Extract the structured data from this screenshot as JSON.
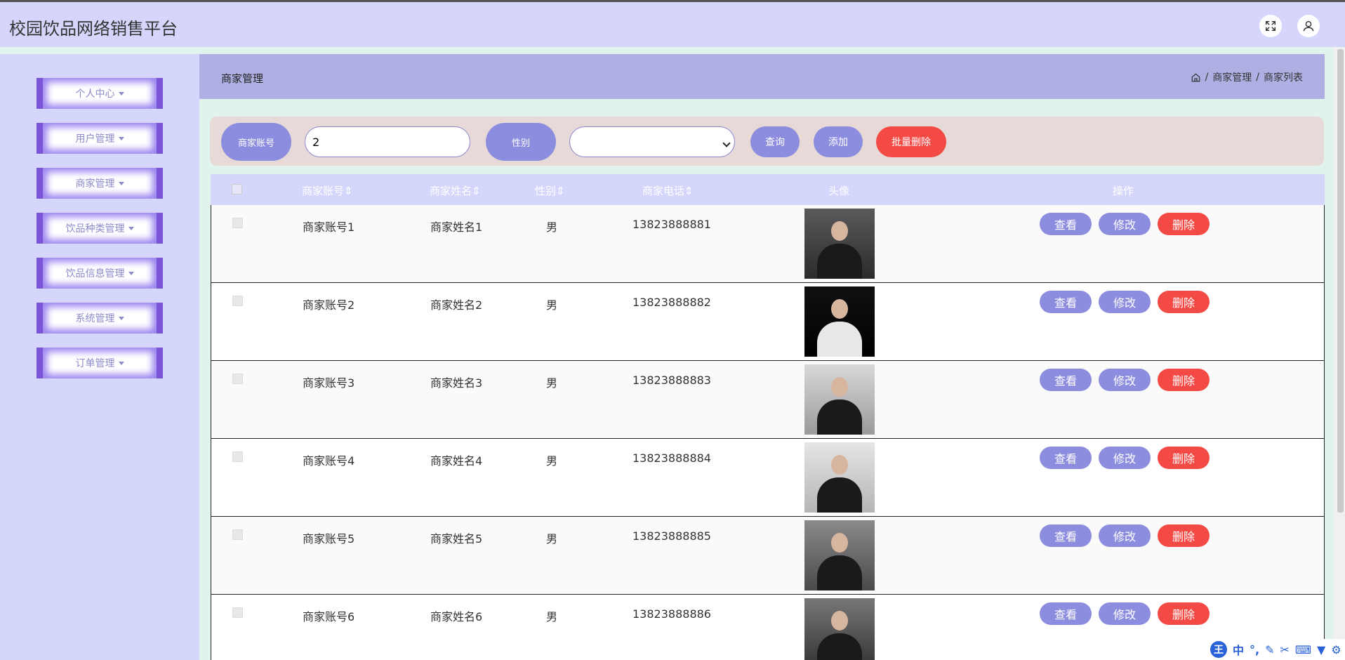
{
  "app": {
    "title": "校园饮品网络销售平台"
  },
  "sidebar": {
    "items": [
      {
        "label": "个人中心"
      },
      {
        "label": "用户管理"
      },
      {
        "label": "商家管理"
      },
      {
        "label": "饮品种类管理"
      },
      {
        "label": "饮品信息管理"
      },
      {
        "label": "系统管理"
      },
      {
        "label": "订单管理"
      }
    ]
  },
  "header": {
    "title": "商家管理",
    "breadcrumb": [
      "商家管理",
      "商家列表"
    ]
  },
  "search": {
    "account_label": "商家账号",
    "account_value": "2",
    "gender_label": "性别",
    "gender_value": "",
    "query_button": "查询",
    "add_button": "添加",
    "batch_delete_button": "批量删除"
  },
  "table": {
    "columns": [
      "商家账号",
      "商家姓名",
      "性别",
      "商家电话",
      "头像",
      "操作"
    ],
    "rows": [
      {
        "account": "商家账号1",
        "name": "商家姓名1",
        "gender": "男",
        "phone": "13823888881"
      },
      {
        "account": "商家账号2",
        "name": "商家姓名2",
        "gender": "男",
        "phone": "13823888882"
      },
      {
        "account": "商家账号3",
        "name": "商家姓名3",
        "gender": "男",
        "phone": "13823888883"
      },
      {
        "account": "商家账号4",
        "name": "商家姓名4",
        "gender": "男",
        "phone": "13823888884"
      },
      {
        "account": "商家账号5",
        "name": "商家姓名5",
        "gender": "男",
        "phone": "13823888885"
      },
      {
        "account": "商家账号6",
        "name": "商家姓名6",
        "gender": "男",
        "phone": "13823888886"
      }
    ],
    "actions": {
      "view": "查看",
      "edit": "修改",
      "delete": "删除"
    }
  },
  "ime": {
    "logo": "王",
    "mode": "中"
  },
  "colors": {
    "accent": "#8c8ddf",
    "danger": "#f34a45",
    "sidebar_border": "#7b55d8"
  }
}
